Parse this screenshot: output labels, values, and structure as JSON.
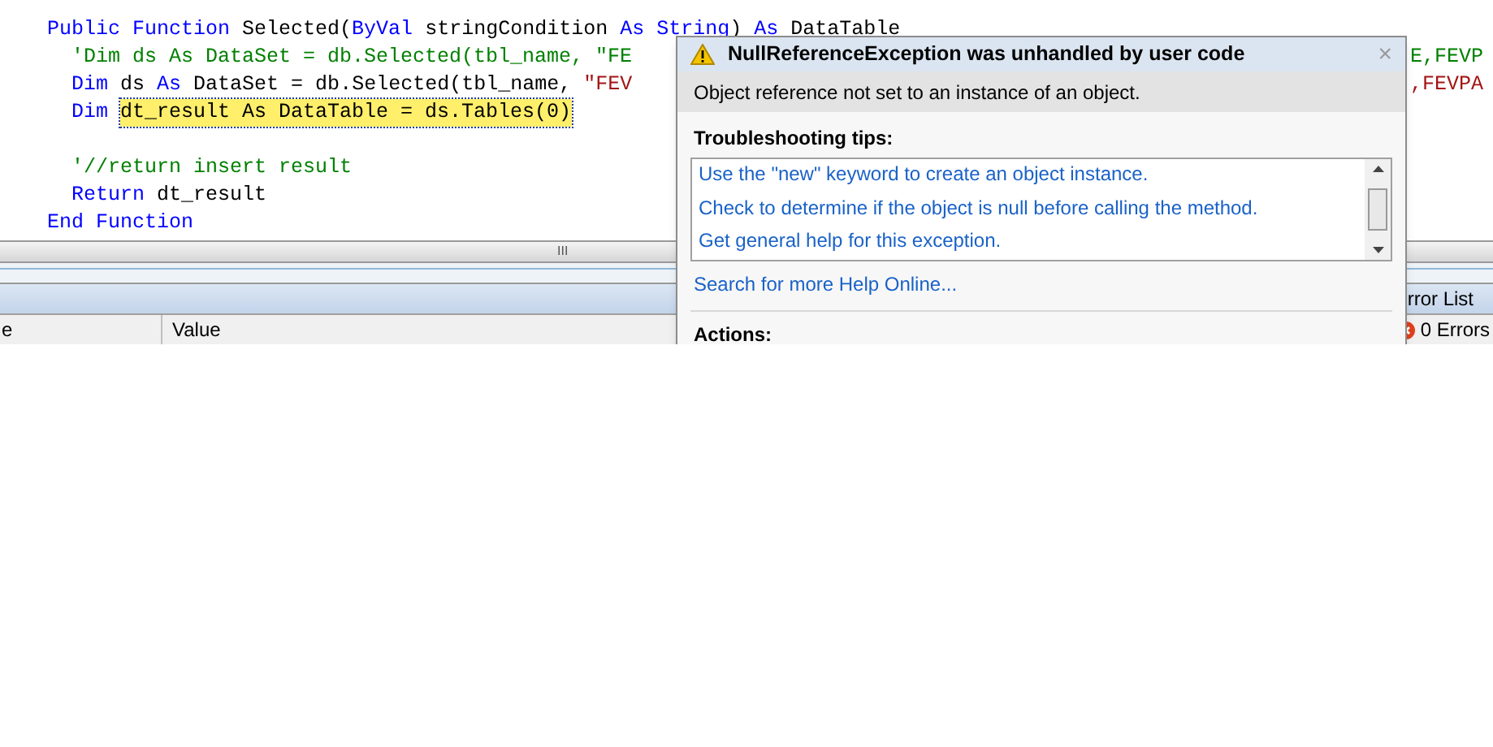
{
  "code_lines": [
    {
      "left": [
        {
          "text": "Public Function ",
          "kind": "keyword"
        },
        {
          "text": "Selected(",
          "kind": "plain"
        },
        {
          "text": "ByVal",
          "kind": "keyword"
        },
        {
          "text": " stringCondition ",
          "kind": "plain"
        },
        {
          "text": "As String",
          "kind": "keyword"
        },
        {
          "text": ") ",
          "kind": "plain"
        },
        {
          "text": "As",
          "kind": "keyword"
        },
        {
          "text": " DataTable",
          "kind": "plain"
        }
      ],
      "indent": false
    },
    {
      "left": [
        {
          "text": "'Dim ds As DataSet = db.Selected(tbl_name, \"FE",
          "kind": "comment"
        }
      ],
      "right": [
        {
          "text": "E,FEVP",
          "kind": "comment"
        }
      ],
      "indent": true
    },
    {
      "left": [
        {
          "text": "Dim",
          "kind": "keyword"
        },
        {
          "text": " ds ",
          "kind": "plain"
        },
        {
          "text": "As",
          "kind": "keyword"
        },
        {
          "text": " DataSet = db.Selected(tbl_name, ",
          "kind": "plain"
        },
        {
          "text": "\"FEV",
          "kind": "string"
        }
      ],
      "right": [
        {
          "text": ",FEVPA",
          "kind": "string"
        }
      ],
      "indent": true
    },
    {
      "left": [
        {
          "text": "Dim ",
          "kind": "keyword"
        },
        {
          "text": "dt_result As DataTable = ds.Tables(0)",
          "kind": "highlight"
        }
      ],
      "indent": true
    },
    {
      "indent": true
    },
    {
      "left": [
        {
          "text": "'//return insert result",
          "kind": "comment"
        }
      ],
      "indent": true
    },
    {
      "left": [
        {
          "text": "Return",
          "kind": "keyword"
        },
        {
          "text": " dt_result",
          "kind": "plain"
        }
      ],
      "indent": true
    },
    {
      "left": [
        {
          "text": "End Function",
          "kind": "keyword"
        }
      ],
      "indent": false
    }
  ],
  "scrollbar_grip": "III",
  "bottom_panel": {
    "tab": "rror List",
    "columns": [
      "e",
      "Value"
    ],
    "errors": "0 Errors"
  },
  "exception_dialog": {
    "title": "NullReferenceException was unhandled by user code",
    "close": "×",
    "message": "Object reference not set to an instance of an object.",
    "tips_heading": "Troubleshooting tips:",
    "tips": [
      "Use the \"new\" keyword to create an object instance.",
      "Check to determine if the object is null before calling the method.",
      "Get general help for this exception."
    ],
    "help_link": "Search for more Help Online...",
    "actions_heading": "Actions:"
  }
}
